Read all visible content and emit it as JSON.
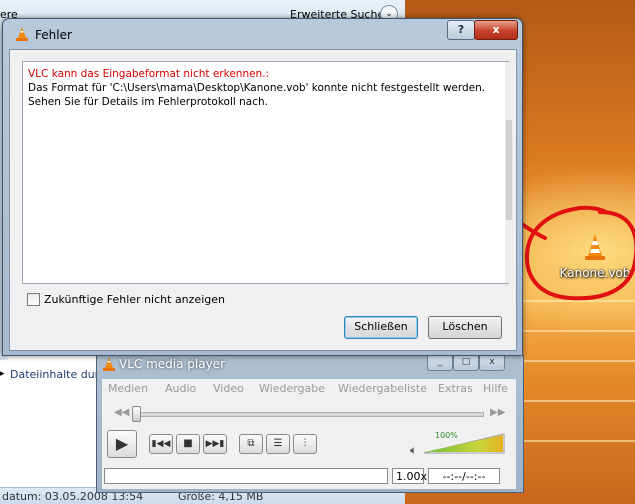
{
  "explorer": {
    "left_title": "ere",
    "search_label": "Erweiterte Suche",
    "chevron": "⌄",
    "details_label": "Dateiinhalte dur",
    "status_date": "datum: 03.05.2008 13:54",
    "status_size": "Größe: 4,15 MB"
  },
  "desktop": {
    "icon_label": "Kanone.vob"
  },
  "dialog": {
    "title": "Fehler",
    "help_button": "?",
    "close_button": "x",
    "error_heading": "VLC kann das Eingabeformat nicht erkennen.:",
    "error_message": "Das Format für 'C:\\Users\\mama\\Desktop\\Kanone.vob' konnte nicht festgestellt werden. Sehen Sie für Details im Fehlerprotokoll nach.",
    "checkbox_label": "Zukünftige Fehler nicht anzeigen",
    "checkbox_checked": false,
    "close_label": "Schließen",
    "clear_label": "Löschen"
  },
  "vlc": {
    "title": "VLC media player",
    "menus": [
      "Medien",
      "Audio",
      "Video",
      "Wiedergabe",
      "Wiedergabeliste",
      "Extras",
      "Hilfe"
    ],
    "volume_percent": "100%",
    "volume_level": 1.0,
    "speed": "1.00x",
    "time": "--:--/--:--",
    "seek_position": 0.0
  },
  "colors": {
    "error_text": "#d40000",
    "annotation_red": "#e01010",
    "volume_green": "#2f8d2f"
  },
  "icons": {
    "vlc": "vlc-cone-icon",
    "chevron": "chevron-down-icon",
    "help": "help-icon",
    "close": "close-icon"
  }
}
